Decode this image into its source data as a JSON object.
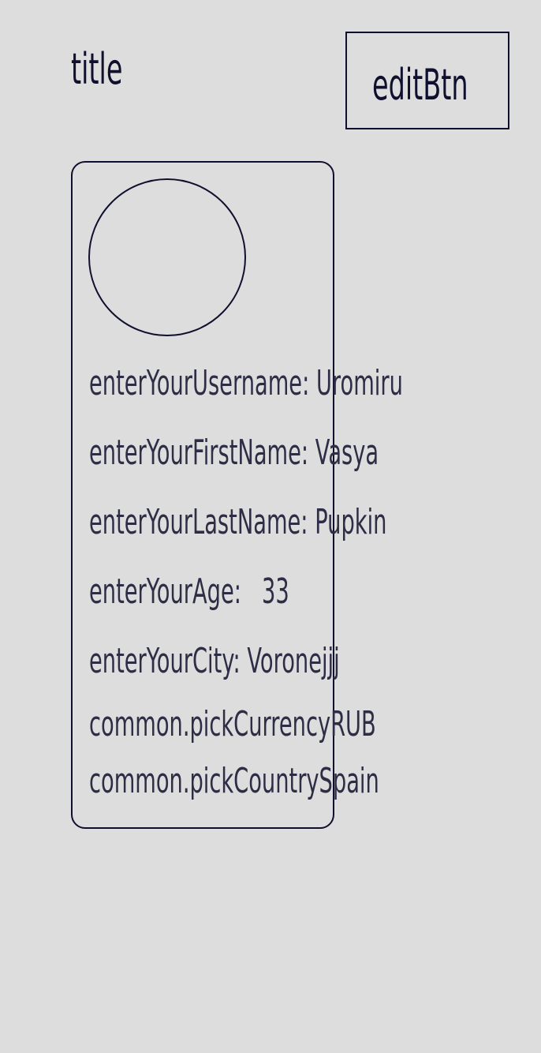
{
  "header": {
    "title": "title",
    "edit_button_label": "editBtn"
  },
  "profile": {
    "username_label": "enterYourUsername:",
    "username": "Uromiru",
    "first_name_label": "enterYourFirstName:",
    "first_name": "Vasya",
    "last_name_label": "enterYourLastName:",
    "last_name": "Pupkin",
    "age_label": "enterYourAge:",
    "age": "33",
    "city_label": "enterYourCity:",
    "city": "Voronejjj",
    "currency_label": "common.pickCurrency",
    "currency": "RUB",
    "country_label": "common.pickCountry",
    "country": "Spain"
  }
}
